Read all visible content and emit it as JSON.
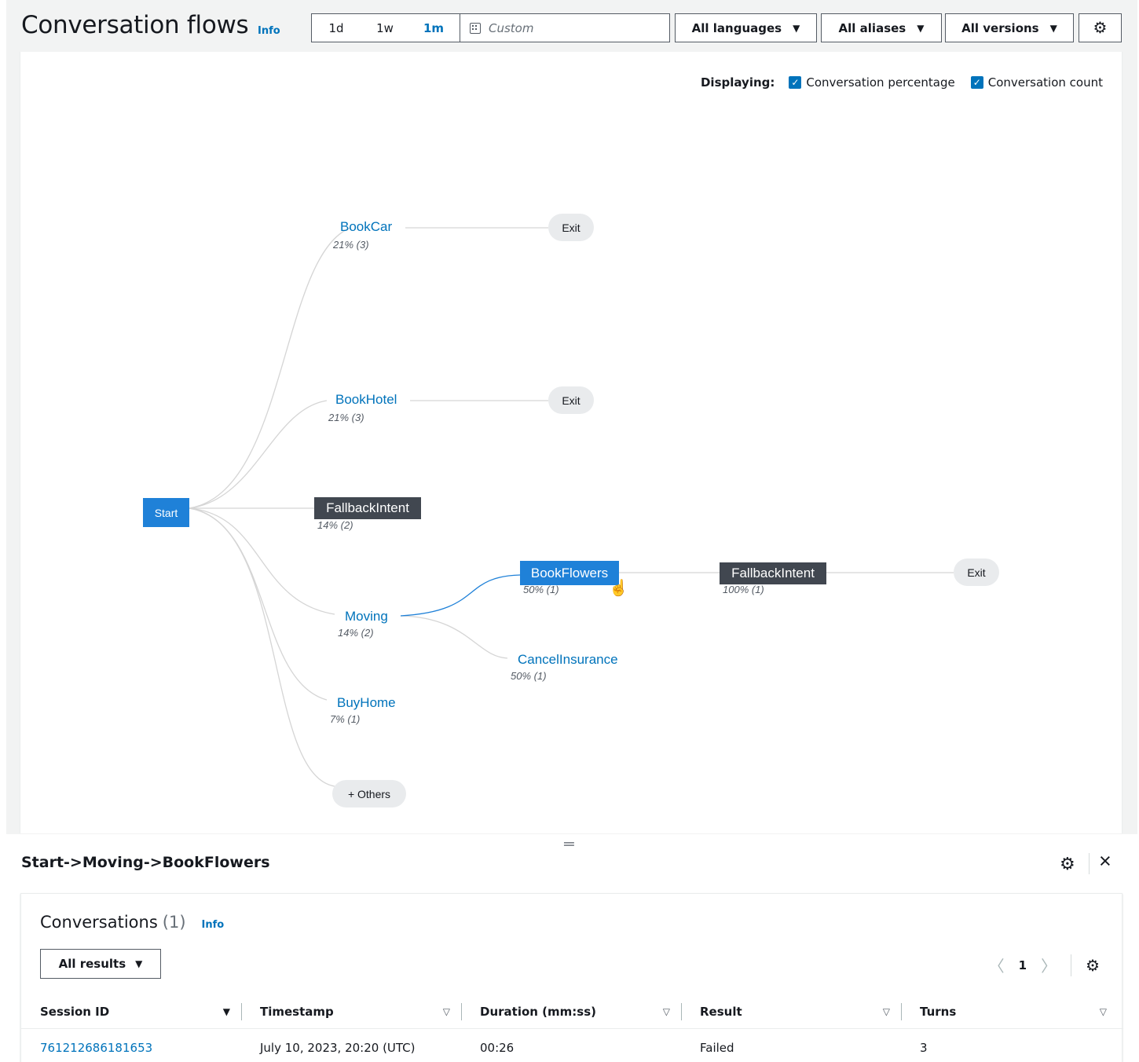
{
  "header": {
    "title": "Conversation flows",
    "info": "Info",
    "ranges": [
      "1d",
      "1w",
      "1m"
    ],
    "active_range": "1m",
    "custom_placeholder": "Custom",
    "languages": "All languages",
    "aliases": "All aliases",
    "versions": "All versions"
  },
  "display_options": {
    "label": "Displaying:",
    "percentage": "Conversation percentage",
    "count": "Conversation count",
    "percentage_checked": true,
    "count_checked": true
  },
  "flow": {
    "start": "Start",
    "level1": [
      {
        "name": "BookCar",
        "meta": "21% (3)",
        "exit": "Exit"
      },
      {
        "name": "BookHotel",
        "meta": "21% (3)",
        "exit": "Exit"
      },
      {
        "name": "FallbackIntent",
        "meta": "14% (2)"
      },
      {
        "name": "Moving",
        "meta": "14% (2)"
      },
      {
        "name": "BuyHome",
        "meta": "7% (1)"
      },
      {
        "name": "+ Others"
      }
    ],
    "level2": [
      {
        "name": "BookFlowers",
        "meta": "50% (1)"
      },
      {
        "name": "CancelInsurance",
        "meta": "50% (1)"
      }
    ],
    "level3": {
      "name": "FallbackIntent",
      "meta": "100% (1)",
      "exit": "Exit"
    }
  },
  "path_panel": {
    "title": "Start->Moving->BookFlowers"
  },
  "conversations": {
    "title": "Conversations",
    "count": "(1)",
    "info": "Info",
    "filter": "All results",
    "page": "1",
    "columns": [
      "Session ID",
      "Timestamp",
      "Duration (mm:ss)",
      "Result",
      "Turns"
    ],
    "rows": [
      {
        "session_id": "761212686181653",
        "timestamp": "July 10, 2023, 20:20 (UTC)",
        "duration": "00:26",
        "result": "Failed",
        "turns": "3"
      }
    ]
  },
  "colors": {
    "link": "#0073bb",
    "node_blue": "#1f81d8",
    "node_dark": "#414750",
    "edge": "#d5d5d5",
    "edge_active": "#1f81d8"
  }
}
